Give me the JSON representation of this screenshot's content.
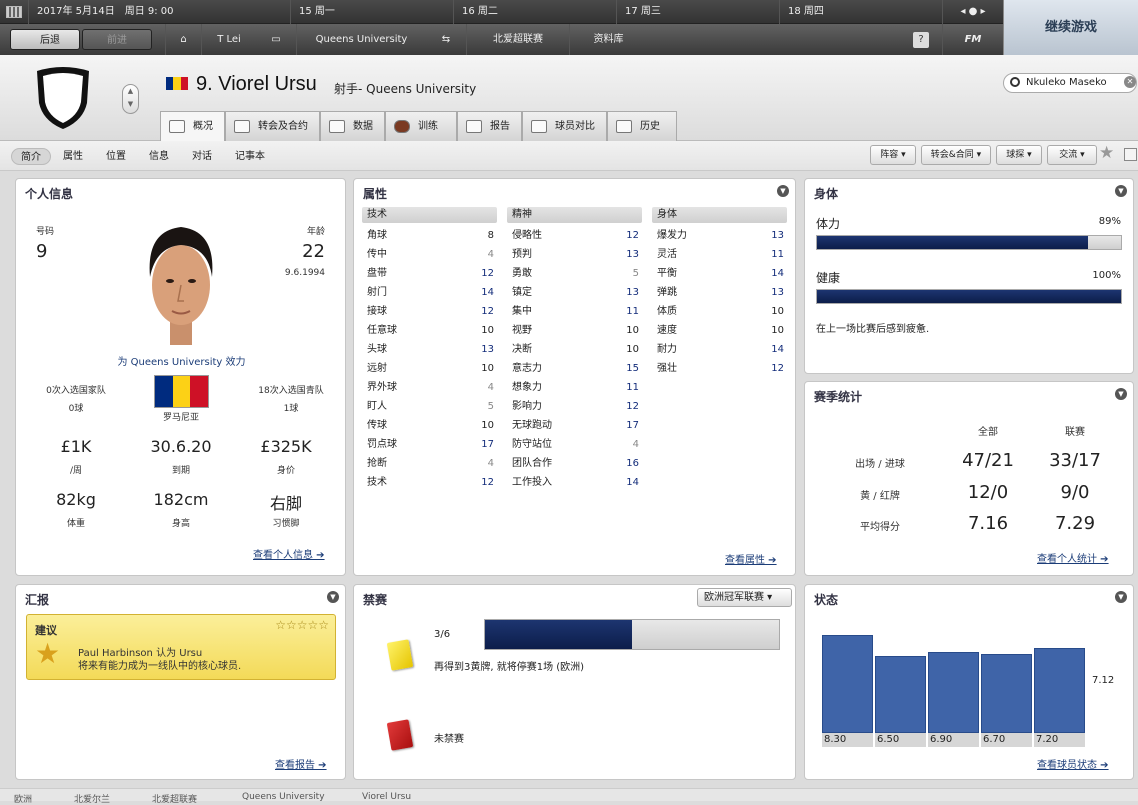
{
  "topbar": {
    "date": "2017年 5月14日　周日 9: 00",
    "days": [
      "15 周一",
      "16 周二",
      "17 周三",
      "18 周四"
    ],
    "back": "后退",
    "forward": "前进",
    "manager": "T Lei",
    "club": "Queens University",
    "league": "北爱超联赛",
    "database": "资料库",
    "help": "?",
    "fm": "FM",
    "continue": "继续游戏"
  },
  "header": {
    "name": "9. Viorel Ursu",
    "position": "射手- Queens University",
    "search": "Nkuleko Maseko",
    "tabs": [
      "概况",
      "转会及合约",
      "数据",
      "训练",
      "报告",
      "球员对比",
      "历史"
    ],
    "subnav": [
      "简介",
      "属性",
      "位置",
      "信息",
      "对话",
      "记事本"
    ],
    "actions": [
      "阵容",
      "转会&合同",
      "球探",
      "交流"
    ]
  },
  "personal": {
    "title": "个人信息",
    "number_label": "号码",
    "number": "9",
    "age_label": "年龄",
    "age": "22",
    "dob": "9.6.1994",
    "plays_for": "为 Queens University 效力",
    "caps_senior": "0次入选国家队",
    "goals_senior": "0球",
    "country": "罗马尼亚",
    "caps_youth": "18次入选国青队",
    "goals_youth": "1球",
    "wage": "£1K",
    "wage_label": "/周",
    "expires": "30.6.20",
    "expires_label": "到期",
    "value": "£325K",
    "value_label": "身价",
    "weight": "82kg",
    "weight_label": "体重",
    "height": "182cm",
    "height_label": "身高",
    "foot": "右脚",
    "foot_label": "习惯脚",
    "link": "查看个人信息"
  },
  "attributes": {
    "title": "属性",
    "technical_label": "技术",
    "technical": [
      {
        "n": "角球",
        "v": "8"
      },
      {
        "n": "传中",
        "v": "4"
      },
      {
        "n": "盘带",
        "v": "12"
      },
      {
        "n": "射门",
        "v": "14"
      },
      {
        "n": "接球",
        "v": "12"
      },
      {
        "n": "任意球",
        "v": "10"
      },
      {
        "n": "头球",
        "v": "13"
      },
      {
        "n": "远射",
        "v": "10"
      },
      {
        "n": "界外球",
        "v": "4"
      },
      {
        "n": "盯人",
        "v": "5"
      },
      {
        "n": "传球",
        "v": "10"
      },
      {
        "n": "罚点球",
        "v": "17"
      },
      {
        "n": "抢断",
        "v": "4"
      },
      {
        "n": "技术",
        "v": "12"
      }
    ],
    "mental_label": "精神",
    "mental": [
      {
        "n": "侵略性",
        "v": "12"
      },
      {
        "n": "预判",
        "v": "13"
      },
      {
        "n": "勇敢",
        "v": "5"
      },
      {
        "n": "镇定",
        "v": "13"
      },
      {
        "n": "集中",
        "v": "11"
      },
      {
        "n": "视野",
        "v": "10"
      },
      {
        "n": "决断",
        "v": "10"
      },
      {
        "n": "意志力",
        "v": "15"
      },
      {
        "n": "想象力",
        "v": "11"
      },
      {
        "n": "影响力",
        "v": "12"
      },
      {
        "n": "无球跑动",
        "v": "17"
      },
      {
        "n": "防守站位",
        "v": "4"
      },
      {
        "n": "团队合作",
        "v": "16"
      },
      {
        "n": "工作投入",
        "v": "14"
      }
    ],
    "physical_label": "身体",
    "physical": [
      {
        "n": "爆发力",
        "v": "13"
      },
      {
        "n": "灵活",
        "v": "11"
      },
      {
        "n": "平衡",
        "v": "14"
      },
      {
        "n": "弹跳",
        "v": "13"
      },
      {
        "n": "体质",
        "v": "10"
      },
      {
        "n": "速度",
        "v": "10"
      },
      {
        "n": "耐力",
        "v": "14"
      },
      {
        "n": "强壮",
        "v": "12"
      }
    ],
    "link": "查看属性"
  },
  "body": {
    "title": "身体",
    "fitness_label": "体力",
    "fitness": "89%",
    "fitness_value": 0.89,
    "health_label": "健康",
    "health": "100%",
    "health_value": 1.0,
    "note": "在上一场比赛后感到疲惫."
  },
  "stats": {
    "title": "赛季统计",
    "col_all": "全部",
    "col_league": "联赛",
    "rows": [
      {
        "label": "出场 / 进球",
        "all": "47/21",
        "league": "33/17"
      },
      {
        "label": "黄 / 红牌",
        "all": "12/0",
        "league": "9/0"
      },
      {
        "label": "平均得分",
        "all": "7.16",
        "league": "7.29"
      }
    ],
    "link": "查看个人统计"
  },
  "report": {
    "title": "汇报",
    "box_title": "建议",
    "stars": "☆☆☆☆☆",
    "line1": "Paul Harbinson 认为 Ursu",
    "line2": "将来有能力成为一线队中的核心球员.",
    "link": "查看报告"
  },
  "bans": {
    "title": "禁赛",
    "competition": "欧洲冠军联赛",
    "yellow_count": "3/6",
    "yellow_value": 0.5,
    "yellow_note": "再得到3黄牌, 就将停赛1场 (欧洲)",
    "red_note": "未禁赛"
  },
  "form": {
    "title": "状态",
    "average": "7.12",
    "ratings": [
      "8.30",
      "6.50",
      "6.90",
      "6.70",
      "7.20"
    ],
    "values": [
      8.3,
      6.5,
      6.9,
      6.7,
      7.2
    ],
    "link": "查看球员状态"
  },
  "bottom": {
    "crumbs": [
      "欧洲",
      "北爱尔兰",
      "北爱超联赛",
      "Queens University",
      "Viorel Ursu"
    ]
  },
  "colors": {
    "accent": "#132c7a",
    "bar": "#0c1d4a",
    "form": "#3f64a8",
    "flag_blue": "#002b7f",
    "flag_yellow": "#fcd116",
    "flag_red": "#ce1126"
  }
}
